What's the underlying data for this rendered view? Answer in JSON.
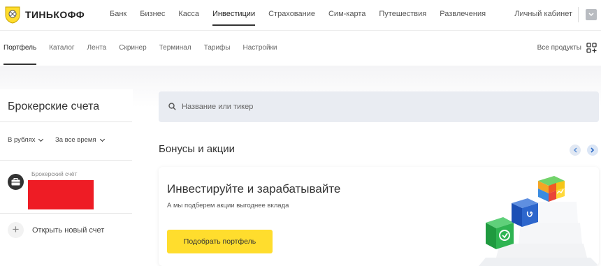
{
  "brand": {
    "name": "ТИНЬКОФФ"
  },
  "top_nav": {
    "items": [
      "Банк",
      "Бизнес",
      "Касса",
      "Инвестиции",
      "Страхование",
      "Сим-карта",
      "Путешествия",
      "Развлечения"
    ],
    "active": "Инвестиции",
    "cabinet": "Личный кабинет"
  },
  "sub_nav": {
    "tabs": [
      "Портфель",
      "Каталог",
      "Лента",
      "Скринер",
      "Терминал",
      "Тарифы",
      "Настройки"
    ],
    "active": "Портфель",
    "all_products": "Все продукты"
  },
  "sidebar": {
    "title": "Брокерские счета",
    "filters": {
      "currency": "В рублях",
      "period": "За все время"
    },
    "account_label": "Брокерский счёт",
    "open_new": "Открыть новый счет"
  },
  "search": {
    "placeholder": "Название или тикер"
  },
  "promo": {
    "section_title": "Бонусы и акции",
    "card_title": "Инвестируйте и зарабатывайте",
    "card_subtitle": "А мы подберем акции выгоднее вклада",
    "button": "Подобрать портфель"
  },
  "colors": {
    "accent_yellow": "#ffdd2d",
    "redaction": "#ee1c25",
    "search_bg": "#e9ecf2"
  }
}
